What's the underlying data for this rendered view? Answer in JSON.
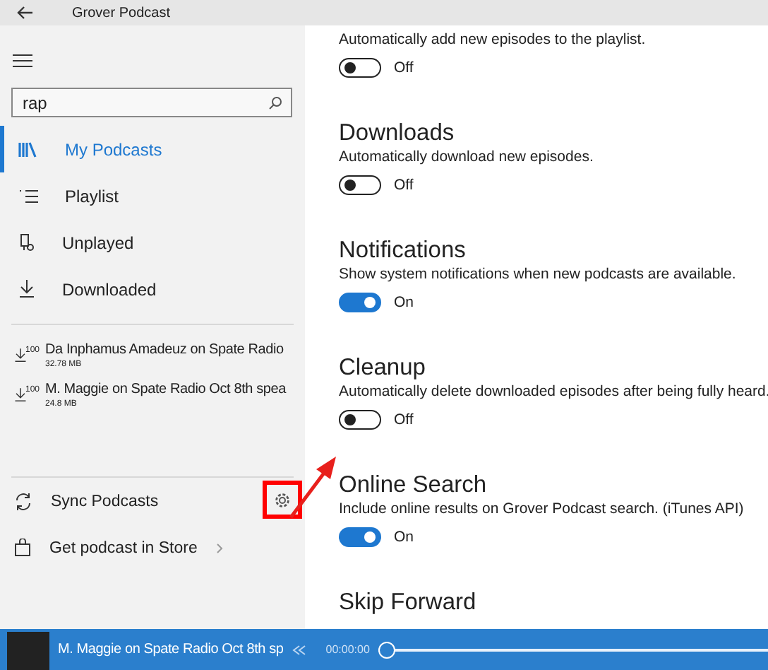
{
  "window": {
    "title": "Grover Podcast"
  },
  "sidebar": {
    "search": {
      "value": "rap"
    },
    "nav": [
      {
        "kind": "library",
        "label": "My Podcasts",
        "selected": true
      },
      {
        "kind": "playlist",
        "label": "Playlist",
        "selected": false
      },
      {
        "kind": "unplayed",
        "label": "Unplayed",
        "selected": false
      },
      {
        "kind": "download",
        "label": "Downloaded",
        "selected": false
      }
    ],
    "downloads": [
      {
        "badge": "100",
        "title": "Da Inphamus Amadeuz on Spate Radio",
        "size": "32.78 MB"
      },
      {
        "badge": "100",
        "title": "M. Maggie on Spate Radio Oct 8th spea",
        "size": "24.8 MB"
      }
    ],
    "footer": [
      {
        "kind": "sync",
        "label": "Sync Podcasts"
      },
      {
        "kind": "store",
        "label": "Get podcast in Store"
      }
    ]
  },
  "settings": [
    {
      "description": "Automatically add new episodes to the playlist.",
      "on": false,
      "state_label": "Off"
    },
    {
      "title": "Downloads",
      "description": "Automatically download new episodes.",
      "on": false,
      "state_label": "Off"
    },
    {
      "title": "Notifications",
      "description": "Show system notifications when new podcasts are available.",
      "on": true,
      "state_label": "On"
    },
    {
      "title": "Cleanup",
      "description": "Automatically delete downloaded episodes after being fully heard.",
      "on": false,
      "state_label": "Off"
    },
    {
      "title": "Online Search",
      "description": "Include online results on Grover Podcast search. (iTunes API)",
      "on": true,
      "state_label": "On"
    },
    {
      "title": "Skip Forward"
    }
  ],
  "player": {
    "title": "M. Maggie on Spate Radio Oct 8th sp",
    "time": "00:00:00",
    "level": 0
  }
}
